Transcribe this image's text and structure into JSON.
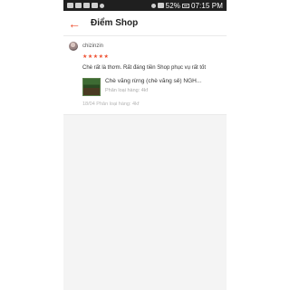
{
  "status_bar": {
    "time": "07:15 PM",
    "icons": [
      "message-icon",
      "facebook-icon",
      "image-icon",
      "mail-icon",
      "wifi-icon",
      "signal-icon",
      "battery-icon"
    ],
    "battery_percent": "52%"
  },
  "header": {
    "back_icon": "arrow-left-icon",
    "title": "Điểm Shop"
  },
  "review": {
    "username": "chizinzin",
    "rating": 5,
    "stars": "★★★★★",
    "comment": "Chè rất là thơm.  Rất đáng tiền Shop phục vụ rất tốt",
    "product": {
      "name": "Chè vằng rừng (chè vằng sẻ) NGH...",
      "variant": "Phân loại hàng: 4kf"
    },
    "meta": "18/04     Phân loại hàng: 4kf"
  },
  "colors": {
    "accent": "#ee4d2d",
    "status_bar_bg": "#1f1f1f",
    "page_bg": "#f4f4f4"
  }
}
